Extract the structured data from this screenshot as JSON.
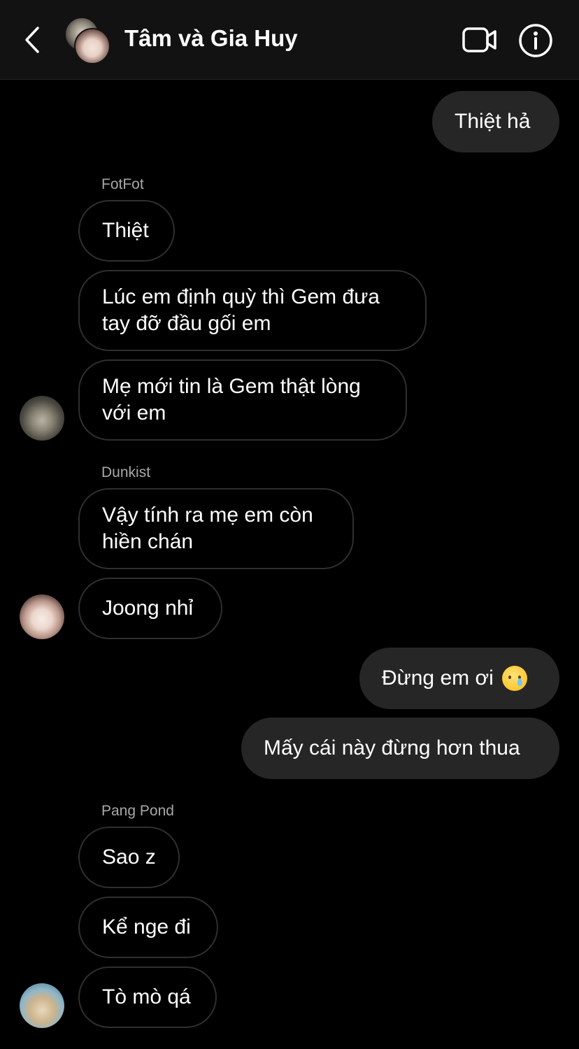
{
  "header": {
    "title": "Tâm và Gia Huy",
    "icons": {
      "back": "chevron-left-icon",
      "video": "video-camera-icon",
      "info": "info-circle-icon"
    }
  },
  "messages": [
    {
      "direction": "out",
      "text": "Thiệt hả"
    },
    {
      "direction": "in",
      "sender": "FotFot",
      "text": "Thiệt"
    },
    {
      "direction": "in",
      "sender": "FotFot",
      "text_line1": "Lúc em định quỳ thì Gem đưa",
      "text_line2": "tay đỡ đầu gối em"
    },
    {
      "direction": "in",
      "sender": "FotFot",
      "text_line1": "Mẹ mới tin là Gem thật lòng",
      "text_line2": "với em"
    },
    {
      "direction": "in",
      "sender": "Dunkist",
      "text_line1": "Vậy tính ra mẹ em còn",
      "text_line2": "hiền chán"
    },
    {
      "direction": "in",
      "sender": "Dunkist",
      "text": "Joong nhỉ"
    },
    {
      "direction": "out",
      "text": "Đừng em ơi",
      "emoji": "crying-face-emoji"
    },
    {
      "direction": "out",
      "text": "Mấy cái này đừng hơn thua"
    },
    {
      "direction": "in",
      "sender": "Pang Pond",
      "text": "Sao z"
    },
    {
      "direction": "in",
      "sender": "Pang Pond",
      "text": "Kể nge đi"
    },
    {
      "direction": "in",
      "sender": "Pang Pond",
      "text": "Tò mò qá"
    }
  ],
  "senders": [
    "FotFot",
    "Dunkist",
    "Pang Pond"
  ],
  "colors": {
    "background": "#000000",
    "header_background": "#121212",
    "outgoing_bubble": "#262626",
    "incoming_border": "#2f2f2f",
    "sender_label": "#a8a8a8"
  }
}
